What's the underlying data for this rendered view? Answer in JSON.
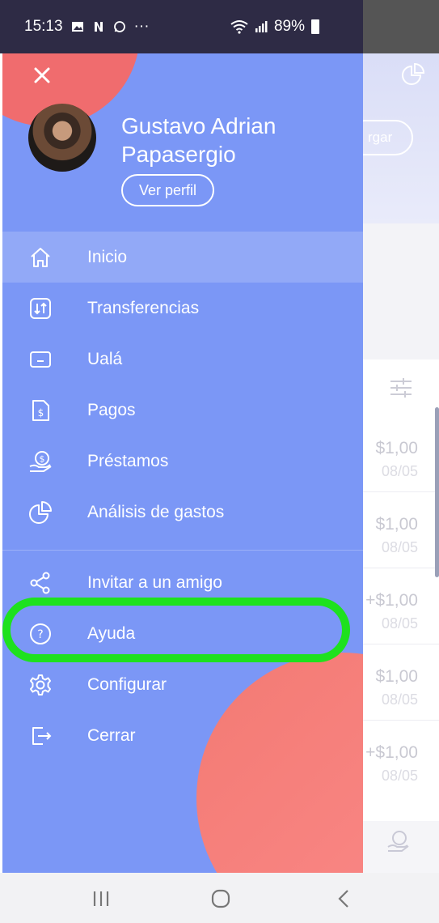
{
  "status_bar": {
    "time": "15:13",
    "left_icons": [
      "image-icon",
      "n-icon",
      "whatsapp-icon",
      "more-icon"
    ],
    "battery": "89%"
  },
  "drawer": {
    "profile": {
      "name": "Gustavo Adrian Papasergio",
      "view_profile": "Ver perfil"
    },
    "menu": [
      {
        "label": "Inicio",
        "icon": "home-icon",
        "active": true
      },
      {
        "label": "Transferencias",
        "icon": "transfer-icon"
      },
      {
        "label": "Ualá",
        "icon": "card-icon"
      },
      {
        "label": "Pagos",
        "icon": "bill-icon"
      },
      {
        "label": "Préstamos",
        "icon": "loan-icon"
      },
      {
        "label": "Análisis de gastos",
        "icon": "pie-chart-icon"
      }
    ],
    "menu2": [
      {
        "label": "Invitar a un amigo",
        "icon": "share-icon"
      },
      {
        "label": "Ayuda",
        "icon": "help-icon"
      },
      {
        "label": "Configurar",
        "icon": "settings-icon"
      },
      {
        "label": "Cerrar",
        "icon": "logout-icon"
      }
    ]
  },
  "background_app": {
    "header_button": "rgar",
    "transactions": [
      {
        "amount": "$1,00",
        "date": "08/05"
      },
      {
        "amount": "$1,00",
        "date": "08/05"
      },
      {
        "amount": "+$1,00",
        "date": "08/05"
      },
      {
        "amount": "$1,00",
        "date": "08/05"
      },
      {
        "amount": "+$1,00",
        "date": "08/05"
      }
    ]
  },
  "colors": {
    "drawer": "#7b97f6",
    "accent_blob": "#f06c6e",
    "highlight": "#1ee11e"
  }
}
